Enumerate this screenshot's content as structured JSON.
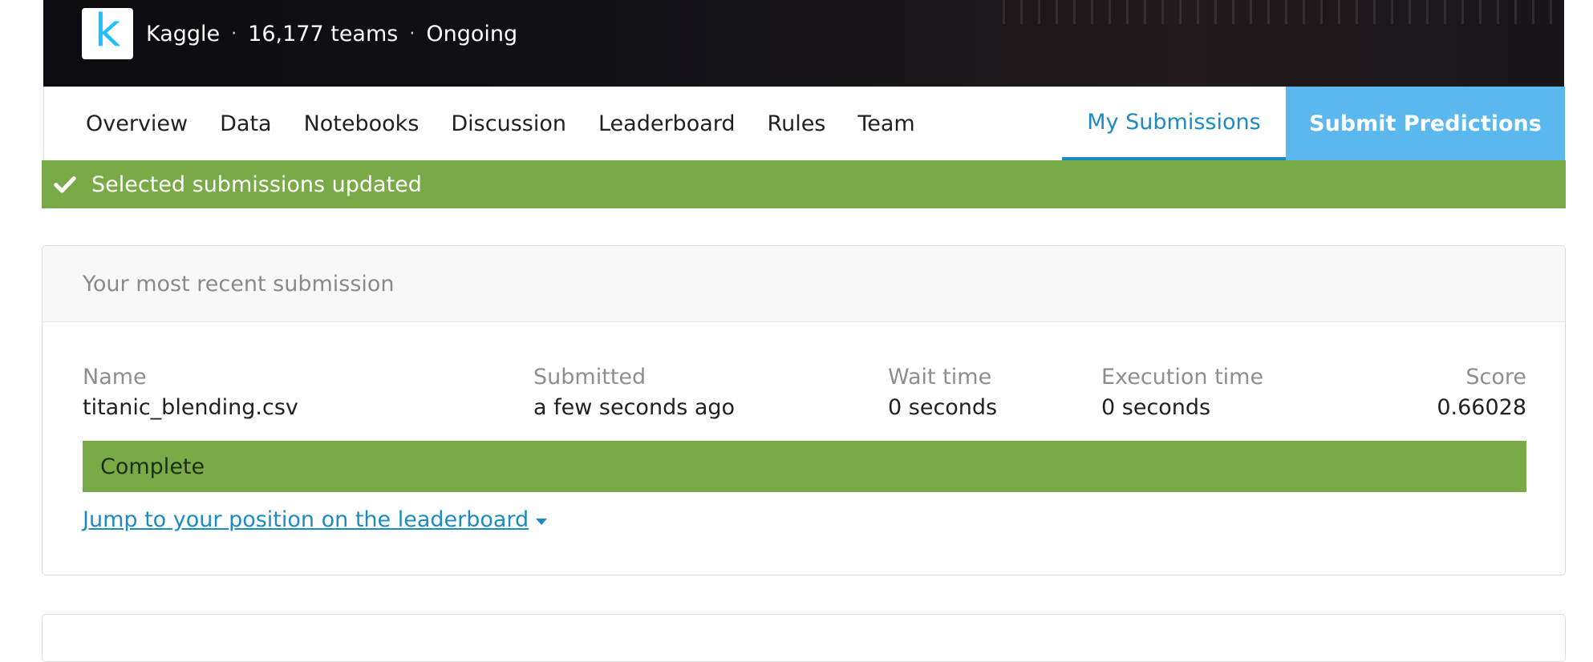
{
  "banner": {
    "logo_letter": "k",
    "org": "Kaggle",
    "separator": "·",
    "teams": "16,177 teams",
    "status": "Ongoing"
  },
  "nav": {
    "tabs": [
      {
        "label": "Overview"
      },
      {
        "label": "Data"
      },
      {
        "label": "Notebooks"
      },
      {
        "label": "Discussion"
      },
      {
        "label": "Leaderboard"
      },
      {
        "label": "Rules"
      },
      {
        "label": "Team"
      }
    ],
    "my_submissions": "My Submissions",
    "submit_predictions": "Submit Predictions"
  },
  "alert": {
    "message": "Selected submissions updated"
  },
  "recent": {
    "header": "Your most recent submission",
    "columns": [
      {
        "label": "Name",
        "value": "titanic_blending.csv"
      },
      {
        "label": "Submitted",
        "value": "a few seconds ago"
      },
      {
        "label": "Wait time",
        "value": "0 seconds"
      },
      {
        "label": "Execution time",
        "value": "0 seconds"
      },
      {
        "label": "Score",
        "value": "0.66028"
      }
    ],
    "status": "Complete",
    "jump_link": "Jump to your position on the leaderboard"
  },
  "colors": {
    "accent_blue": "#1c8bc0",
    "submit_blue": "#5ab8ef",
    "success_green": "#7aaa47",
    "logo_blue": "#20beff"
  }
}
